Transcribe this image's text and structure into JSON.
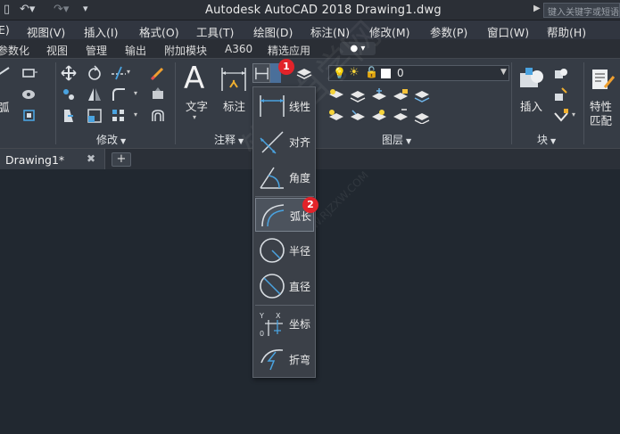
{
  "titlebar": {
    "title": "Autodesk AutoCAD 2018    Drawing1.dwg",
    "search_placeholder": "键入关键字或短语",
    "undo_icon": "undo-icon",
    "redo_icon": "redo-icon"
  },
  "menubar": {
    "items": [
      "E)",
      "视图(V)",
      "插入(I)",
      "格式(O)",
      "工具(T)",
      "绘图(D)",
      "标注(N)",
      "修改(M)",
      "参数(P)",
      "窗口(W)",
      "帮助(H)"
    ]
  },
  "ribbon_tabs": {
    "items": [
      "参数化",
      "视图",
      "管理",
      "输出",
      "附加模块",
      "A360",
      "精选应用"
    ]
  },
  "ribbon": {
    "arc_partial": "弧",
    "text_label": "文字",
    "dim_label": "标注",
    "insert_label": "插入",
    "match_label_1": "特性",
    "match_label_2": "匹配",
    "layer_value": "0",
    "panels": {
      "modify": "修改",
      "annotation": "注释",
      "layer": "图层",
      "block": "块"
    }
  },
  "document": {
    "tab_label": "Drawing1*"
  },
  "dim_menu": {
    "items": [
      {
        "label": "线性",
        "icon": "linear-dim-icon"
      },
      {
        "label": "对齐",
        "icon": "aligned-dim-icon"
      },
      {
        "label": "角度",
        "icon": "angular-dim-icon"
      },
      {
        "label": "弧长",
        "icon": "arc-length-dim-icon"
      },
      {
        "label": "半径",
        "icon": "radius-dim-icon"
      },
      {
        "label": "直径",
        "icon": "diameter-dim-icon"
      },
      {
        "label": "坐标",
        "icon": "ordinate-dim-icon"
      },
      {
        "label": "折弯",
        "icon": "jogged-dim-icon"
      }
    ]
  },
  "badges": {
    "one": "1",
    "two": "2"
  },
  "colors": {
    "accent": "#4aa3e0",
    "badge": "#e2232a",
    "canvas": "#212830"
  },
  "watermark": {
    "text": "软件自学网",
    "url": "WWW.RJZXW.COM"
  }
}
